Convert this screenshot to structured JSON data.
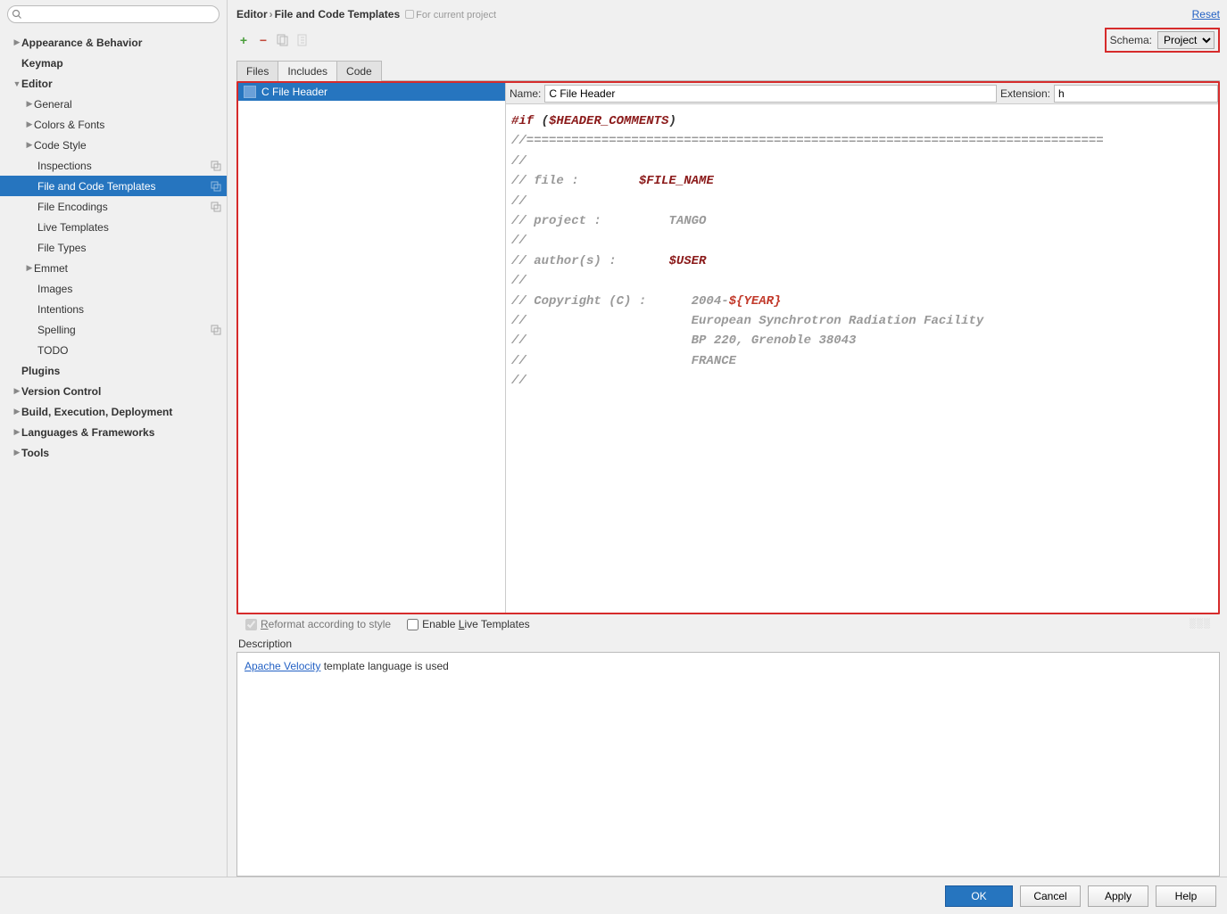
{
  "search": {
    "placeholder": ""
  },
  "breadcrumb": {
    "parent": "Editor",
    "current": "File and Code Templates",
    "note": "For current project",
    "reset": "Reset"
  },
  "schema": {
    "label": "Schema:",
    "value": "Project"
  },
  "tabs": {
    "files": "Files",
    "includes": "Includes",
    "code": "Code"
  },
  "tree": {
    "appearance": "Appearance & Behavior",
    "keymap": "Keymap",
    "editor": "Editor",
    "general": "General",
    "colors_fonts": "Colors & Fonts",
    "code_style": "Code Style",
    "inspections": "Inspections",
    "file_code_templates": "File and Code Templates",
    "file_encodings": "File Encodings",
    "live_templates": "Live Templates",
    "file_types": "File Types",
    "emmet": "Emmet",
    "images": "Images",
    "intentions": "Intentions",
    "spelling": "Spelling",
    "todo": "TODO",
    "plugins": "Plugins",
    "version_control": "Version Control",
    "build": "Build, Execution, Deployment",
    "languages": "Languages & Frameworks",
    "tools": "Tools"
  },
  "include_list": {
    "item0": "C File Header"
  },
  "form": {
    "name_label": "Name:",
    "name_value": "C File Header",
    "ext_label": "Extension:",
    "ext_value": "h"
  },
  "code": {
    "l1a": "#if",
    "l1b": " (",
    "l1c": "$HEADER_COMMENTS",
    "l1d": ")",
    "l2": "//=============================================================================",
    "l3": "//",
    "l4a": "// file :        ",
    "l4b": "$FILE_NAME",
    "l5": "//",
    "l6": "// project :         TANGO",
    "l7": "//",
    "l8a": "// author(s) :       ",
    "l8b": "$USER",
    "l9": "//",
    "l10a": "// Copyright (C) :      2004-",
    "l10b": "${YEAR}",
    "l11": "//                      European Synchrotron Radiation Facility",
    "l12": "//                      BP 220, Grenoble 38043",
    "l13": "//                      FRANCE",
    "l14": "//"
  },
  "options": {
    "reformat": "Reformat according to style",
    "live": "Enable Live Templates",
    "reformat_pre": "R",
    "reformat_post": "eformat according to style",
    "live_pre": "Enable ",
    "live_u": "L",
    "live_post": "ive Templates"
  },
  "description": {
    "label": "Description",
    "link": "Apache Velocity",
    "text": " template language is used"
  },
  "footer": {
    "ok": "OK",
    "cancel": "Cancel",
    "apply": "Apply",
    "help": "Help"
  }
}
